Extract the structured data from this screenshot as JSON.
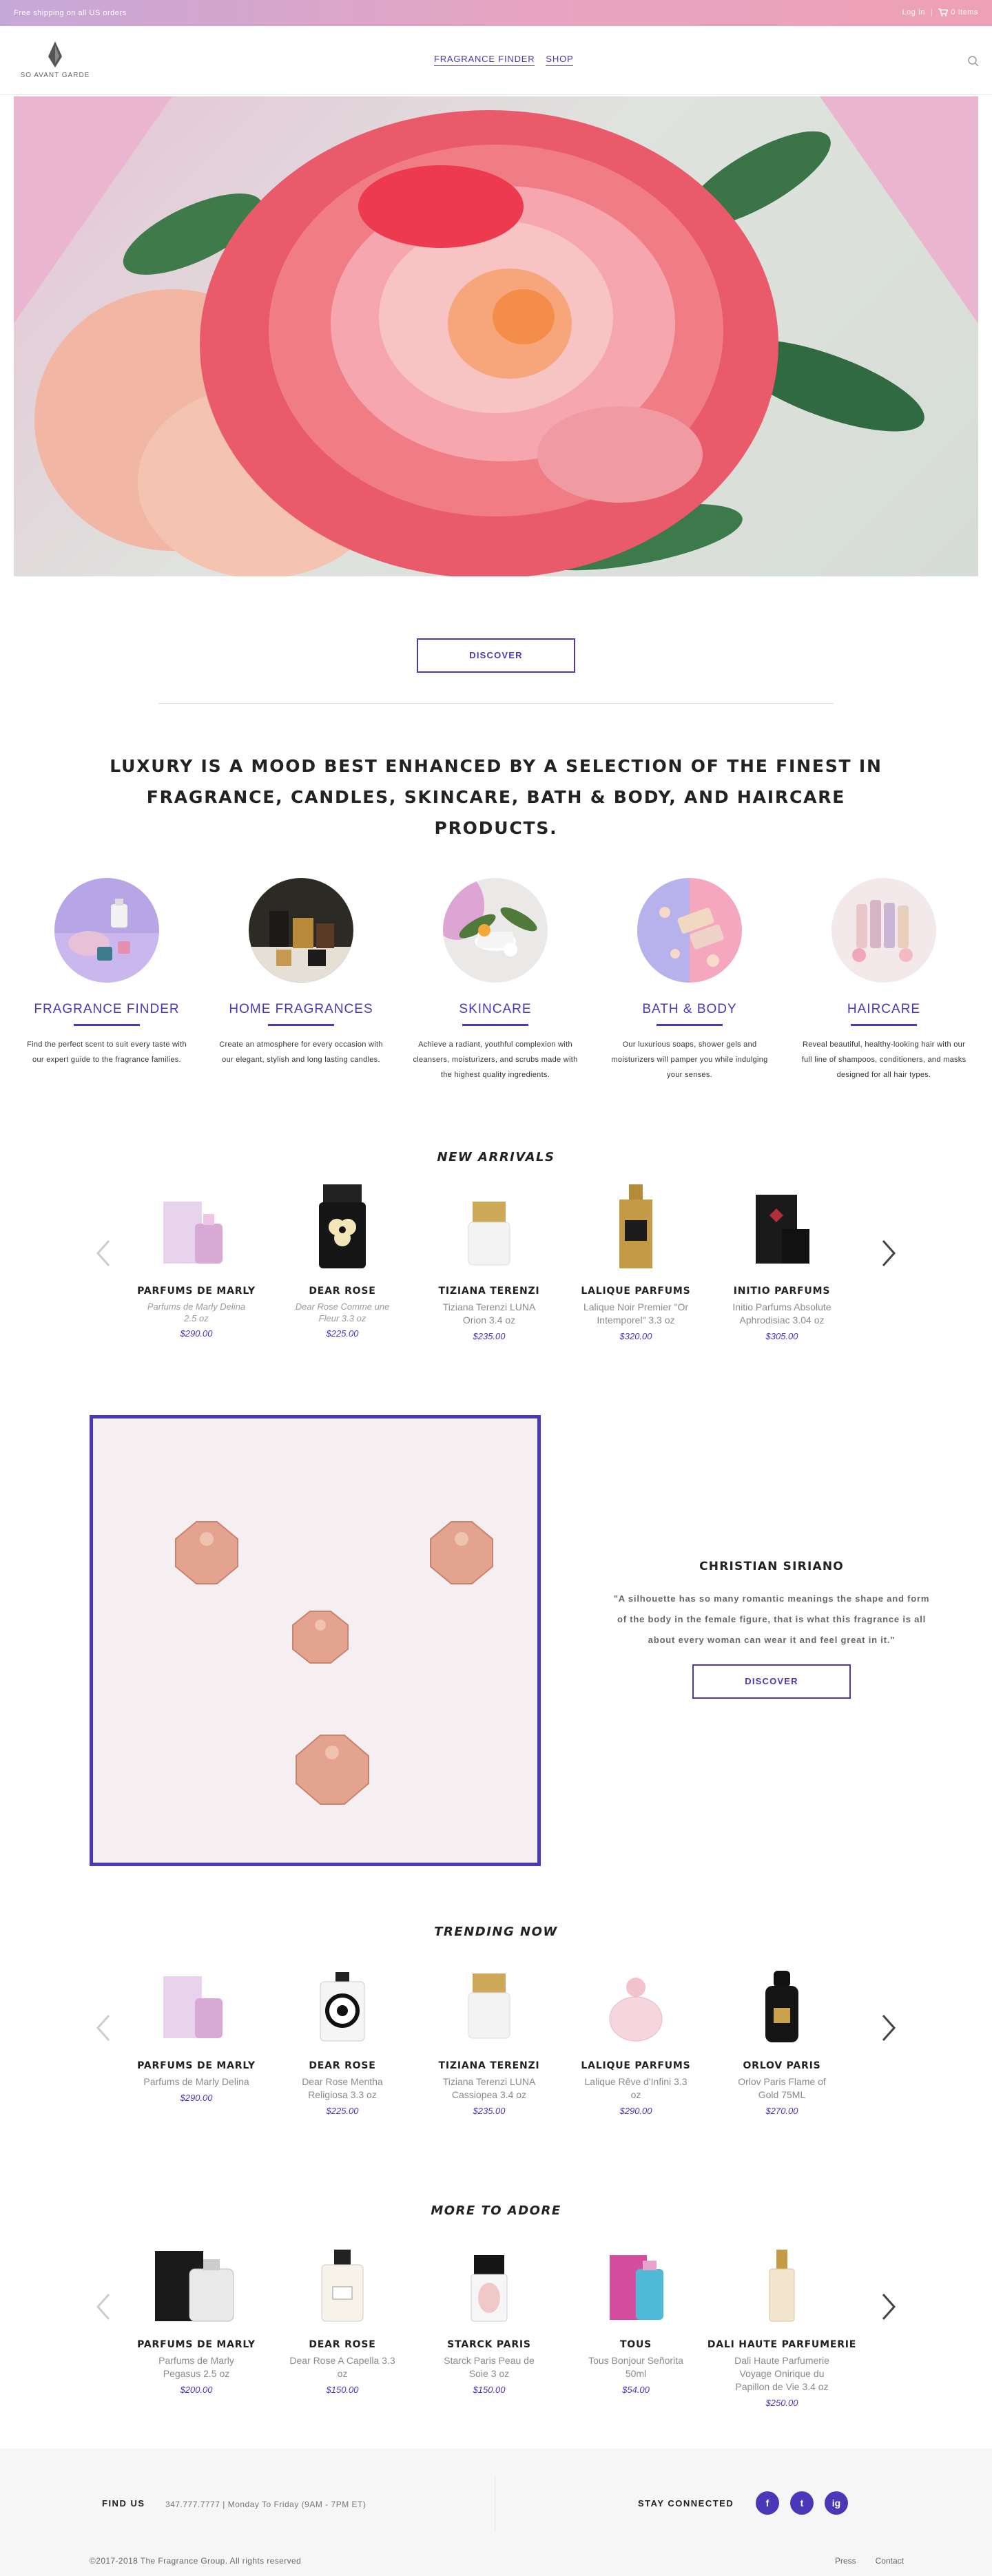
{
  "topbar": {
    "shipping": "Free shipping on all US orders",
    "login": "Log In",
    "cart": "0 Items"
  },
  "header": {
    "logo_text": "SO AVANT GARDE",
    "nav": [
      "FRAGRANCE FINDER",
      "SHOP"
    ]
  },
  "hero": {
    "button": "DISCOVER"
  },
  "tagline": "LUXURY IS A MOOD BEST ENHANCED BY A SELECTION OF THE FINEST IN FRAGRANCE, CANDLES, SKINCARE, BATH & BODY, AND HAIRCARE PRODUCTS.",
  "categories": [
    {
      "title": "FRAGRANCE FINDER",
      "desc": "Find the perfect scent to suit every taste with our expert guide to the fragrance families."
    },
    {
      "title": "HOME FRAGRANCES",
      "desc": "Create an atmosphere for every occasion with our elegant, stylish and long lasting candles."
    },
    {
      "title": "SKINCARE",
      "desc": "Achieve a radiant, youthful complexion with cleansers, moisturizers, and scrubs made with the highest quality ingredients."
    },
    {
      "title": "BATH & BODY",
      "desc": "Our luxurious soaps, shower gels and moisturizers will pamper you while indulging your senses."
    },
    {
      "title": "HAIRCARE",
      "desc": "Reveal beautiful, healthy-looking hair with our full line of shampoos, conditioners, and masks designed for all hair types."
    }
  ],
  "new_arrivals": {
    "title": "NEW ARRIVALS",
    "products": [
      {
        "brand": "PARFUMS DE MARLY",
        "name": "Parfums de Marly Delina 2.5 oz",
        "price": "$290.00"
      },
      {
        "brand": "DEAR ROSE",
        "name": "Dear Rose Comme une Fleur 3.3 oz",
        "price": "$225.00"
      },
      {
        "brand": "TIZIANA TERENZI",
        "name": "Tiziana Terenzi LUNA Orion 3.4 oz",
        "price": "$235.00"
      },
      {
        "brand": "LALIQUE PARFUMS",
        "name": "Lalique Noir Premier \"Or Intemporel\" 3.3 oz",
        "price": "$320.00"
      },
      {
        "brand": "INITIO PARFUMS",
        "name": "Initio Parfums Absolute Aphrodisiac 3.04 oz",
        "price": "$305.00"
      }
    ]
  },
  "feature": {
    "name": "CHRISTIAN SIRIANO",
    "quote": "\"A silhouette has so many romantic meanings the shape and form of the body in the female figure, that is what this fragrance is all about every woman can wear it and feel great in it.\"",
    "button": "DISCOVER"
  },
  "trending": {
    "title": "TRENDING NOW",
    "products": [
      {
        "brand": "PARFUMS DE MARLY",
        "name": "Parfums de Marly Delina",
        "price": "$290.00"
      },
      {
        "brand": "DEAR ROSE",
        "name": "Dear Rose Mentha Religiosa 3.3 oz",
        "price": "$225.00"
      },
      {
        "brand": "TIZIANA TERENZI",
        "name": "Tiziana Terenzi LUNA Cassiopea 3.4 oz",
        "price": "$235.00"
      },
      {
        "brand": "LALIQUE PARFUMS",
        "name": "Lalique Rêve d'Infini 3.3 oz",
        "price": "$290.00"
      },
      {
        "brand": "ORLOV PARIS",
        "name": "Orlov Paris Flame of Gold 75ML",
        "price": "$270.00"
      }
    ]
  },
  "adore": {
    "title": "MORE TO ADORE",
    "products": [
      {
        "brand": "PARFUMS DE MARLY",
        "name": "Parfums de Marly Pegasus 2.5 oz",
        "price": "$200.00"
      },
      {
        "brand": "DEAR ROSE",
        "name": "Dear Rose A Capella 3.3 oz",
        "price": "$150.00"
      },
      {
        "brand": "STARCK PARIS",
        "name": "Starck Paris Peau de Soie 3 oz",
        "price": "$150.00"
      },
      {
        "brand": "TOUS",
        "name": "Tous Bonjour Señorita 50ml",
        "price": "$54.00"
      },
      {
        "brand": "DALI HAUTE PARFUMERIE",
        "name": "Dali Haute Parfumerie Voyage Onirique du Papillon de Vie 3.4 oz",
        "price": "$250.00"
      }
    ]
  },
  "footer": {
    "find_us": "FIND US",
    "phone": "347.777.7777  |  Monday To Friday (9AM - 7PM ET)",
    "stay": "STAY CONNECTED",
    "social": [
      "f",
      "t",
      "ig"
    ],
    "copyright": "©2017-2018 The Fragrance Group. All rights reserved",
    "links": [
      "Press",
      "Contact"
    ]
  },
  "colors": {
    "accent": "#4a38b8",
    "topbar_start": "#c6a8d8",
    "topbar_end": "#eea0b6"
  },
  "icons": [
    "cart-icon",
    "search-icon",
    "arrow-left-icon",
    "arrow-right-icon",
    "facebook-icon",
    "twitter-icon",
    "instagram-icon"
  ]
}
